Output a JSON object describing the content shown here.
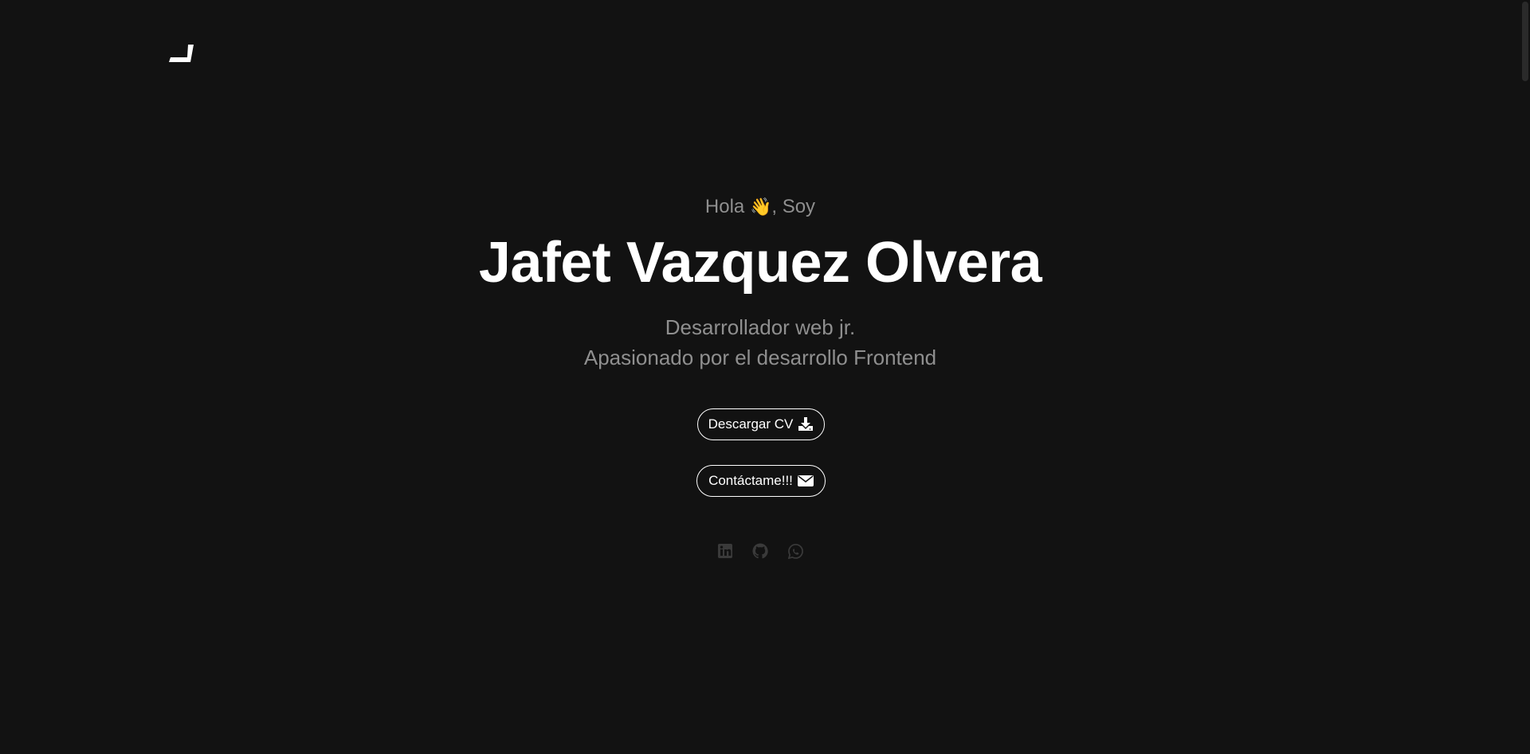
{
  "header": {
    "logo_icon": "terminal-underscore-logo"
  },
  "hero": {
    "greeting_prefix": "Hola",
    "greeting_emoji": "👋",
    "greeting_suffix": ", Soy",
    "name": "Jafet Vazquez Olvera",
    "role": "Desarrollador web jr.",
    "tagline": "Apasionado por el desarrollo Frontend"
  },
  "buttons": {
    "cv_label": "Descargar CV",
    "cv_icon": "download-icon",
    "contact_label": "Contáctame!!!",
    "contact_icon": "envelope-icon"
  },
  "socials": [
    {
      "icon": "linkedin-icon"
    },
    {
      "icon": "github-icon"
    },
    {
      "icon": "whatsapp-icon"
    }
  ],
  "colors": {
    "background": "#121212",
    "text_primary": "#ffffff",
    "text_muted": "#8f8f8f",
    "social_icon": "#3a3a3a"
  }
}
